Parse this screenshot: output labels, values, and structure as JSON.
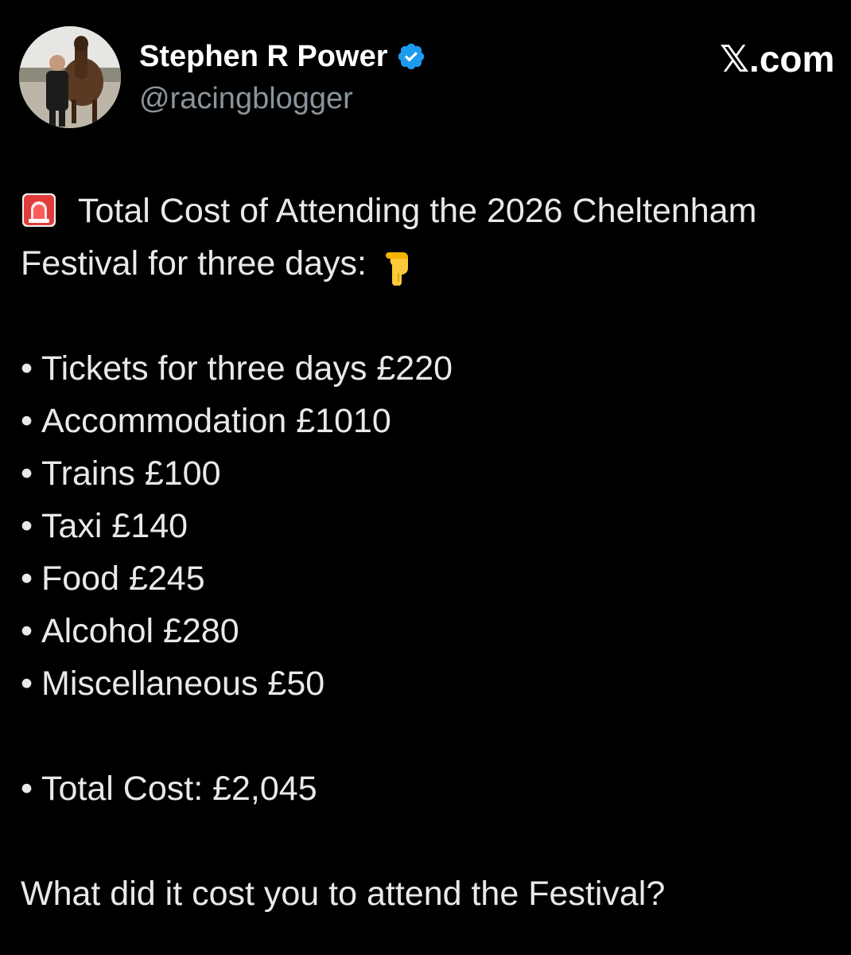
{
  "author": {
    "display_name": "Stephen R Power",
    "handle": "@racingblogger",
    "verified": true,
    "verified_color": "#1d9bf0"
  },
  "brand": "𝕏.com",
  "tweet": {
    "intro_line1": "Total Cost of Attending the 2026 Cheltenham",
    "intro_line2": "Festival for three days:",
    "emoji_start": "rotating-light-icon",
    "emoji_end": "pointing-down-icon",
    "bullet_char": "•",
    "items": [
      {
        "text": "Tickets for three days £220"
      },
      {
        "text": "Accommodation £1010"
      },
      {
        "text": "Trains £100"
      },
      {
        "text": "Taxi £140"
      },
      {
        "text": "Food £245"
      },
      {
        "text": "Alcohol £280"
      },
      {
        "text": "Miscellaneous £50"
      }
    ],
    "total": "Total Cost: £2,045",
    "question": "What did it cost you to attend the Festival?"
  },
  "colors": {
    "background": "#000000",
    "text": "#e7e9ea",
    "secondary_text": "#8b949b"
  }
}
